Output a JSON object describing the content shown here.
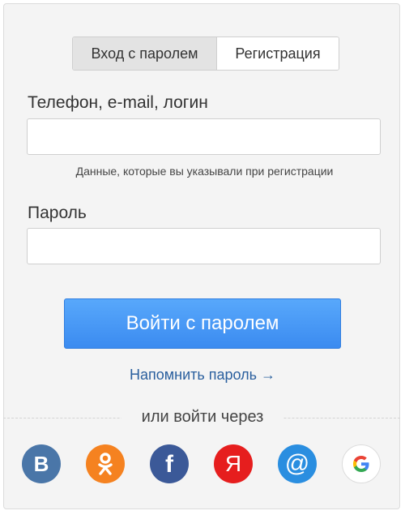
{
  "tabs": [
    {
      "label": "Вход с паролем",
      "active": true
    },
    {
      "label": "Регистрация",
      "active": false
    }
  ],
  "login": {
    "label": "Телефон, e-mail, логин",
    "value": "",
    "hint": "Данные, которые вы указывали при регистрации"
  },
  "password": {
    "label": "Пароль",
    "value": ""
  },
  "submit_label": "Войти с паролем",
  "remind_label": "Напомнить пароль →",
  "alt_login_label": "или войти через",
  "social": [
    {
      "name": "vk-icon",
      "glyph": "В",
      "color": "#4a76a8"
    },
    {
      "name": "odnoklassniki-icon",
      "color": "#f58220"
    },
    {
      "name": "facebook-icon",
      "glyph": "f",
      "color": "#3b5998"
    },
    {
      "name": "yandex-icon",
      "glyph": "Я",
      "color": "#e61e1e"
    },
    {
      "name": "mailru-icon",
      "glyph": "@",
      "color": "#2a8ee0"
    },
    {
      "name": "google-icon",
      "glyph": "G",
      "color": "#ffffff"
    }
  ]
}
